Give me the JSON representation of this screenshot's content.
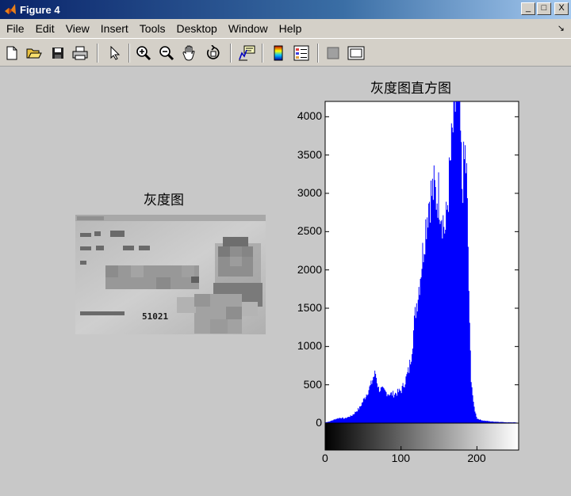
{
  "window": {
    "title": "Figure 4",
    "minimize_label": "_",
    "maximize_label": "□",
    "close_label": "X"
  },
  "menu": {
    "items": [
      "File",
      "Edit",
      "View",
      "Insert",
      "Tools",
      "Desktop",
      "Window",
      "Help"
    ],
    "more_arrow": "↘"
  },
  "toolbar": {
    "icons": [
      "new-figure-icon",
      "open-file-icon",
      "save-icon",
      "print-icon",
      "edit-plot-arrow-icon",
      "zoom-in-icon",
      "zoom-out-icon",
      "pan-hand-icon",
      "rotate-3d-icon",
      "data-cursor-icon",
      "colorbar-icon",
      "legend-icon",
      "hide-plot-tools-icon",
      "show-plot-tools-icon"
    ]
  },
  "gray_image_panel": {
    "title": "灰度图",
    "card_number_visible": "51021"
  },
  "chart_data": {
    "type": "bar",
    "title": "灰度图直方图",
    "xlabel": "",
    "ylabel": "",
    "xlim": [
      0,
      255
    ],
    "ylim": [
      0,
      4200
    ],
    "x_ticks": [
      "0",
      "100",
      "200"
    ],
    "y_ticks": [
      "0",
      "500",
      "1000",
      "1500",
      "2000",
      "2500",
      "3000",
      "3500",
      "4000"
    ],
    "series_color": "#0000ff",
    "colorbar": "grayscale 0-255",
    "approx_profile": [
      [
        0,
        10
      ],
      [
        5,
        20
      ],
      [
        10,
        40
      ],
      [
        15,
        60
      ],
      [
        20,
        70
      ],
      [
        25,
        60
      ],
      [
        30,
        80
      ],
      [
        35,
        100
      ],
      [
        40,
        150
      ],
      [
        45,
        200
      ],
      [
        50,
        300
      ],
      [
        55,
        400
      ],
      [
        60,
        500
      ],
      [
        63,
        600
      ],
      [
        66,
        650
      ],
      [
        70,
        450
      ],
      [
        75,
        430
      ],
      [
        80,
        400
      ],
      [
        85,
        380
      ],
      [
        90,
        380
      ],
      [
        95,
        400
      ],
      [
        100,
        430
      ],
      [
        105,
        550
      ],
      [
        110,
        700
      ],
      [
        113,
        900
      ],
      [
        116,
        1200
      ],
      [
        119,
        1500
      ],
      [
        122,
        1700
      ],
      [
        125,
        1950
      ],
      [
        128,
        2200
      ],
      [
        131,
        2500
      ],
      [
        134,
        2750
      ],
      [
        137,
        2950
      ],
      [
        140,
        3000
      ],
      [
        143,
        3050
      ],
      [
        146,
        2950
      ],
      [
        149,
        3000
      ],
      [
        152,
        2850
      ],
      [
        155,
        2650
      ],
      [
        158,
        2500
      ],
      [
        161,
        2900
      ],
      [
        164,
        3300
      ],
      [
        167,
        3700
      ],
      [
        170,
        4100
      ],
      [
        172,
        4200
      ],
      [
        174,
        4200
      ],
      [
        176,
        4150
      ],
      [
        178,
        3700
      ],
      [
        180,
        3100
      ],
      [
        182,
        3300
      ],
      [
        184,
        3500
      ],
      [
        186,
        3200
      ],
      [
        188,
        2300
      ],
      [
        190,
        1200
      ],
      [
        192,
        600
      ],
      [
        195,
        250
      ],
      [
        198,
        120
      ],
      [
        200,
        60
      ],
      [
        205,
        40
      ],
      [
        210,
        30
      ],
      [
        220,
        20
      ],
      [
        230,
        15
      ],
      [
        240,
        10
      ],
      [
        250,
        10
      ],
      [
        255,
        0
      ]
    ]
  }
}
